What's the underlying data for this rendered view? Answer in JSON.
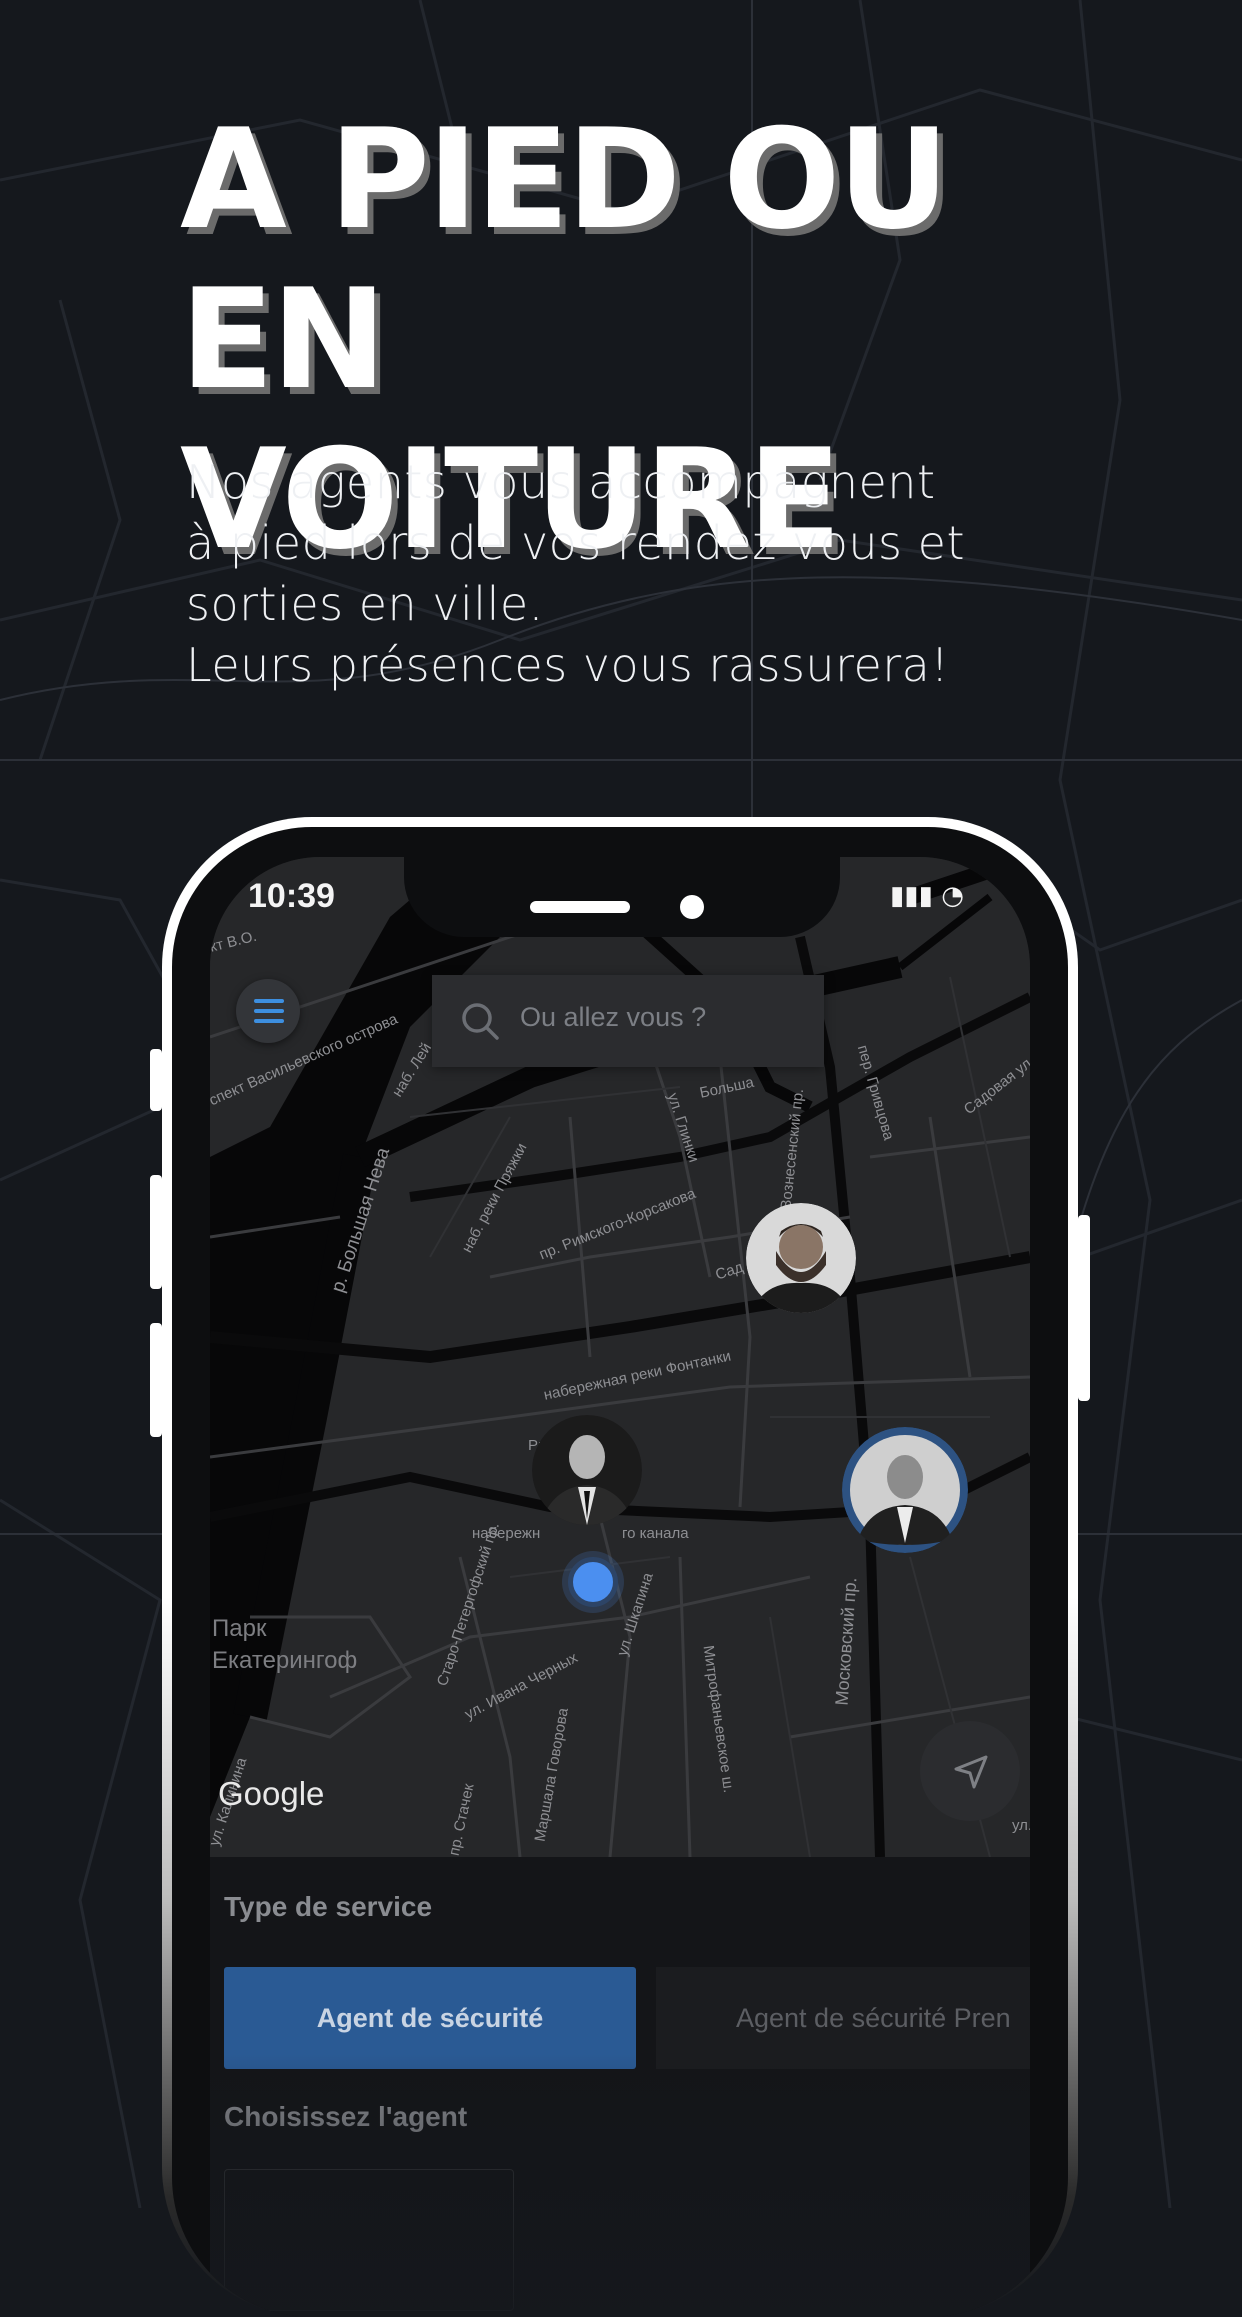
{
  "headline": {
    "line1": "A PIED OU",
    "line2": "EN VOITURE"
  },
  "subtitle": {
    "line1": "Nos agents vous accompagnent",
    "line2": "à pied lors de vos rendez vous et",
    "line3": "sorties en ville.",
    "line4": "Leurs présences vous rassurera!"
  },
  "status_bar": {
    "time": "10:39"
  },
  "search": {
    "placeholder": "Ou allez vous ?"
  },
  "map": {
    "labels": [
      "кт В.О.",
      "спект Васильевского острова",
      "наб. Лей",
      "р. Большая Нева",
      "наб. реки Пряжки",
      "пр. Римского-Корсакова",
      "ул. Глинки",
      "Больша",
      "Вознесенский пр.",
      "пер. Гривцова",
      "Садовая ул.",
      "Сад",
      "набережная реки Фонтанки",
      "Рижский пр.",
      "набережн",
      "го канала",
      "Старо-Петергофский пр.",
      "ул. Ивана Черных",
      "ул. Шкапина",
      "Маршала Говорова",
      "Митрофаньевское ш.",
      "Московский пр.",
      "ул. Калинина",
      "пр. Стачек",
      "ул."
    ],
    "park": "Парк Екатерингоф",
    "attribution": "Google"
  },
  "panel": {
    "service_title": "Type de service",
    "service_options": [
      "Agent de sécurité",
      "Agent de sécurité Pren"
    ],
    "agent_title": "Choisissez l'agent"
  },
  "colors": {
    "background": "#15181d",
    "accent": "#2a5a94",
    "user_dot": "#4b8ff0"
  }
}
